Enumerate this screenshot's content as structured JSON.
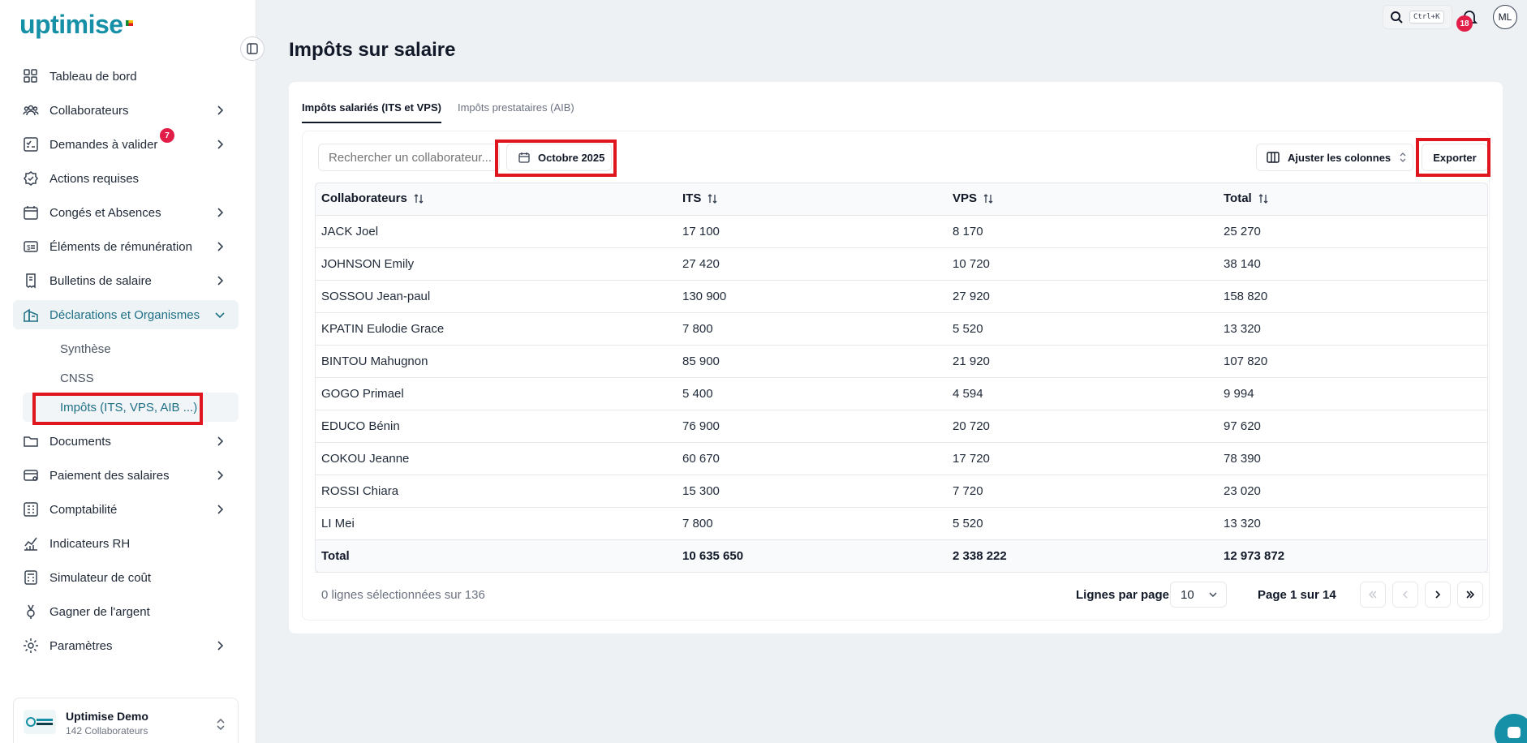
{
  "app": {
    "brand": "uptimise",
    "page_title": "Impôts sur salaire"
  },
  "topbar": {
    "search_shortcut": "Ctrl+K",
    "notification_count": "18",
    "user_initials": "ML"
  },
  "sidebar": {
    "items": [
      {
        "label": "Tableau de bord",
        "icon": "dashboard-grid-icon"
      },
      {
        "label": "Collaborateurs",
        "icon": "users-icon"
      },
      {
        "label": "Demandes à valider",
        "icon": "checklist-icon",
        "badge": "7"
      },
      {
        "label": "Actions requises",
        "icon": "check-badge-icon"
      },
      {
        "label": "Congés et Absences",
        "icon": "calendar-icon"
      },
      {
        "label": "Éléments de rémunération",
        "icon": "money-card-icon"
      },
      {
        "label": "Bulletins de salaire",
        "icon": "payslip-icon"
      },
      {
        "label": "Déclarations et Organismes",
        "icon": "building-icon"
      },
      {
        "label": "Documents",
        "icon": "folder-icon"
      },
      {
        "label": "Paiement des salaires",
        "icon": "payment-card-icon"
      },
      {
        "label": "Comptabilité",
        "icon": "ledger-icon"
      },
      {
        "label": "Indicateurs RH",
        "icon": "chart-icon"
      },
      {
        "label": "Simulateur de coût",
        "icon": "calculator-icon"
      },
      {
        "label": "Gagner de l'argent",
        "icon": "medal-icon"
      },
      {
        "label": "Paramètres",
        "icon": "gear-icon"
      }
    ],
    "sub_items": [
      "Synthèse",
      "CNSS",
      "Impôts (ITS, VPS, AIB ...)"
    ],
    "org": {
      "name": "Uptimise Demo",
      "subtitle": "142 Collaborateurs",
      "logo_text": "DEMO UPTIMISE"
    }
  },
  "main": {
    "tabs": [
      "Impôts salariés (ITS et VPS)",
      "Impôts prestataires (AIB)"
    ],
    "search_placeholder": "Rechercher un collaborateur...",
    "period": "Octobre 2025",
    "adjust_columns": "Ajuster les colonnes",
    "export": "Exporter",
    "columns": [
      "Collaborateurs",
      "ITS",
      "VPS",
      "Total"
    ],
    "rows": [
      [
        "JACK Joel",
        "17 100",
        "8 170",
        "25 270"
      ],
      [
        "JOHNSON Emily",
        "27 420",
        "10 720",
        "38 140"
      ],
      [
        "SOSSOU Jean-paul",
        "130 900",
        "27 920",
        "158 820"
      ],
      [
        "KPATIN Eulodie Grace",
        "7 800",
        "5 520",
        "13 320"
      ],
      [
        "BINTOU Mahugnon",
        "85 900",
        "21 920",
        "107 820"
      ],
      [
        "GOGO Primael",
        "5 400",
        "4 594",
        "9 994"
      ],
      [
        "EDUCO Bénin",
        "76 900",
        "20 720",
        "97 620"
      ],
      [
        "COKOU Jeanne",
        "60 670",
        "17 720",
        "78 390"
      ],
      [
        "ROSSI Chiara",
        "15 300",
        "7 720",
        "23 020"
      ],
      [
        "LI Mei",
        "7 800",
        "5 520",
        "13 320"
      ]
    ],
    "total": [
      "Total",
      "10 635 650",
      "2 338 222",
      "12 973 872"
    ],
    "footer": {
      "selected": "0 lignes sélectionnées sur 136",
      "rows_per_page_label": "Lignes par page",
      "rows_per_page": "10",
      "page_info": "Page 1 sur 14"
    }
  },
  "colors": {
    "brand": "#1590a6",
    "highlight": "#e0161f",
    "badge": "#e11d48"
  }
}
